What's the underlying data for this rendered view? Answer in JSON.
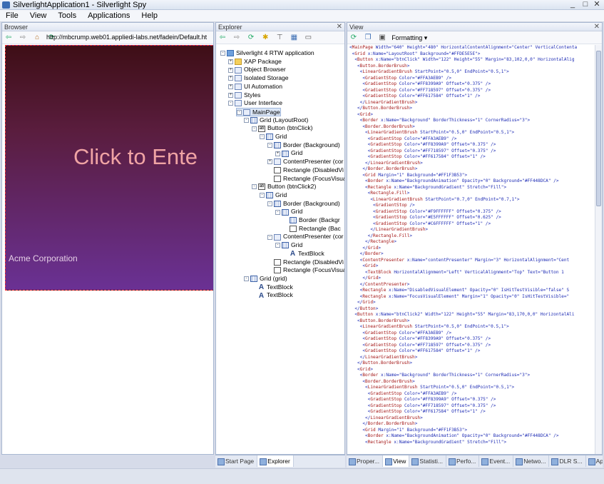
{
  "window": {
    "title": "SilverlightApplication1 - Silverlight Spy",
    "minimize": "_",
    "maximize": "□",
    "close": "✕"
  },
  "menu": [
    "File",
    "View",
    "Tools",
    "Applications",
    "Help"
  ],
  "browser": {
    "panel_title": "Browser",
    "url": "http://mbcrump.web01.appliedi-labs.net/fadein/Default.ht",
    "click_text": "Click to Ente",
    "corp_text": "Acme Corporation"
  },
  "explorer": {
    "panel_title": "Explorer",
    "tree": [
      {
        "label": "Silverlight 4 RTW application",
        "icon": "app-icon"
      },
      {
        "label": "XAP Package",
        "icon": "folder-icon"
      },
      {
        "label": "Object Browser",
        "icon": "object-icon"
      },
      {
        "label": "Isolated Storage",
        "icon": "storage-icon"
      },
      {
        "label": "UI Automation",
        "icon": "automation-icon"
      },
      {
        "label": "Styles",
        "icon": "styles-icon"
      },
      {
        "label": "User Interface",
        "icon": "ui-icon"
      },
      {
        "label": "MainPage",
        "icon": "page-icon"
      },
      {
        "label": "Grid (LayoutRoot)",
        "icon": "grid-icon"
      },
      {
        "label": "Button (btnClick)",
        "icon": "button-icon"
      },
      {
        "label": "Grid",
        "icon": "grid-icon"
      },
      {
        "label": "Border (Background)",
        "icon": "border-icon"
      },
      {
        "label": "Grid",
        "icon": "grid-icon"
      },
      {
        "label": "ContentPresenter (cor",
        "icon": "content-icon"
      },
      {
        "label": "Rectangle (DisabledVi",
        "icon": "rect-icon"
      },
      {
        "label": "Rectangle (FocusVisua",
        "icon": "rect-icon"
      },
      {
        "label": "Button (btnClick2)",
        "icon": "button-icon"
      },
      {
        "label": "Grid",
        "icon": "grid-icon"
      },
      {
        "label": "Border (Background)",
        "icon": "border-icon"
      },
      {
        "label": "Grid",
        "icon": "grid-icon"
      },
      {
        "label": "Border (Backgr",
        "icon": "border-icon"
      },
      {
        "label": "Rectangle (Bac",
        "icon": "rect-icon"
      },
      {
        "label": "ContentPresenter (cor",
        "icon": "content-icon"
      },
      {
        "label": "Grid",
        "icon": "grid-icon"
      },
      {
        "label": "TextBlock",
        "icon": "textblock-icon"
      },
      {
        "label": "Rectangle (DisabledVi",
        "icon": "rect-icon"
      },
      {
        "label": "Rectangle (FocusVisua",
        "icon": "rect-icon"
      },
      {
        "label": "Grid (grid)",
        "icon": "grid-icon"
      },
      {
        "label": "TextBlock",
        "icon": "textblock-icon"
      },
      {
        "label": "TextBlock",
        "icon": "textblock-icon"
      }
    ],
    "tabs": [
      "Start Page",
      "Explorer"
    ]
  },
  "view": {
    "panel_title": "View",
    "formatting_label": "Formatting ▾",
    "code": [
      "<MainPage Width=\"640\" Height=\"480\" HorizontalContentAlignment=\"Center\" VerticalContenta",
      " <Grid x:Name=\"LayoutRoot\" Background=\"#FFDE5E5E\">",
      "  <Button x:Name=\"btnClick\" Width=\"122\" Height=\"55\" Margin=\"83,102,0,0\" HorizontalAlig",
      "   <Button.BorderBrush>",
      "    <LinearGradientBrush StartPoint=\"0.5,0\" EndPoint=\"0.5,1\">",
      "     <GradientStop Color=\"#FFA3AEB9\" />",
      "     <GradientStop Color=\"#FF8399A9\" Offset=\"0.375\" />",
      "     <GradientStop Color=\"#FF718597\" Offset=\"0.375\" />",
      "     <GradientStop Color=\"#FF617584\" Offset=\"1\" />",
      "    </LinearGradientBrush>",
      "   </Button.BorderBrush>",
      "   <Grid>",
      "    <Border x:Name=\"Background\" BorderThickness=\"1\" CornerRadius=\"3\">",
      "     <Border.BorderBrush>",
      "      <LinearGradientBrush StartPoint=\"0.5,0\" EndPoint=\"0.5,1\">",
      "       <GradientStop Color=\"#FFA3AEB9\" />",
      "       <GradientStop Color=\"#FF8399A9\" Offset=\"0.375\" />",
      "       <GradientStop Color=\"#FF718597\" Offset=\"0.375\" />",
      "       <GradientStop Color=\"#FF617584\" Offset=\"1\" />",
      "      </LinearGradientBrush>",
      "     </Border.BorderBrush>",
      "     <Grid Margin=\"1\" Background=\"#FF1F3B53\">",
      "      <Border x:Name=\"BackgroundAnimation\" Opacity=\"0\" Background=\"#FF448DCA\" />",
      "      <Rectangle x:Name=\"BackgroundGradient\" Stretch=\"Fill\">",
      "       <Rectangle.Fill>",
      "        <LinearGradientBrush StartPoint=\"0.7,0\" EndPoint=\"0.7,1\">",
      "         <GradientStop />",
      "         <GradientStop Color=\"#F9FFFFFF\" Offset=\"0.375\" />",
      "         <GradientStop Color=\"#E5FFFFFF\" Offset=\"0.625\" />",
      "         <GradientStop Color=\"#C6FFFFFF\" Offset=\"1\" />",
      "        </LinearGradientBrush>",
      "       </Rectangle.Fill>",
      "      </Rectangle>",
      "     </Grid>",
      "    </Border>",
      "    <ContentPresenter x:Name=\"contentPresenter\" Margin=\"3\" HorizontalAlignment=\"Cent",
      "     <Grid>",
      "      <TextBlock HorizontalAlignment=\"Left\" VerticalAlignment=\"Top\" Text=\"Button 1",
      "     </Grid>",
      "    </ContentPresenter>",
      "    <Rectangle x:Name=\"DisabledVisualElement\" Opacity=\"0\" IsHitTestVisible=\"false\" S",
      "    <Rectangle x:Name=\"FocusVisualElement\" Margin=\"1\" Opacity=\"0\" IsHitTestVisible=\"",
      "   </Grid>",
      "  </Button>",
      "  <Button x:Name=\"btnClick2\" Width=\"122\" Height=\"55\" Margin=\"83,170,0,0\" HorizontalAli",
      "   <Button.BorderBrush>",
      "    <LinearGradientBrush StartPoint=\"0.5,0\" EndPoint=\"0.5,1\">",
      "     <GradientStop Color=\"#FFA3AEB9\" />",
      "     <GradientStop Color=\"#FF8399A9\" Offset=\"0.375\" />",
      "     <GradientStop Color=\"#FF718597\" Offset=\"0.375\" />",
      "     <GradientStop Color=\"#FF617584\" Offset=\"1\" />",
      "    </LinearGradientBrush>",
      "   </Button.BorderBrush>",
      "   <Grid>",
      "    <Border x:Name=\"Background\" BorderThickness=\"1\" CornerRadius=\"3\">",
      "     <Border.BorderBrush>",
      "      <LinearGradientBrush StartPoint=\"0.5,0\" EndPoint=\"0.5,1\">",
      "       <GradientStop Color=\"#FFA3AEB9\" />",
      "       <GradientStop Color=\"#FF8399A9\" Offset=\"0.375\" />",
      "       <GradientStop Color=\"#FF718597\" Offset=\"0.375\" />",
      "       <GradientStop Color=\"#FF617584\" Offset=\"1\" />",
      "      </LinearGradientBrush>",
      "     </Border.BorderBrush>",
      "     <Grid Margin=\"1\" Background=\"#FF1F3B53\">",
      "      <Border x:Name=\"BackgroundAnimation\" Opacity=\"0\" Background=\"#FF448DCA\" />",
      "      <Rectangle x:Name=\"BackgroundGradient\" Stretch=\"Fill\">"
    ],
    "tabs": [
      "Proper...",
      "View",
      "Statisti...",
      "Perfo...",
      "Event...",
      "Netwo...",
      "DLR S...",
      "Applic..."
    ]
  }
}
